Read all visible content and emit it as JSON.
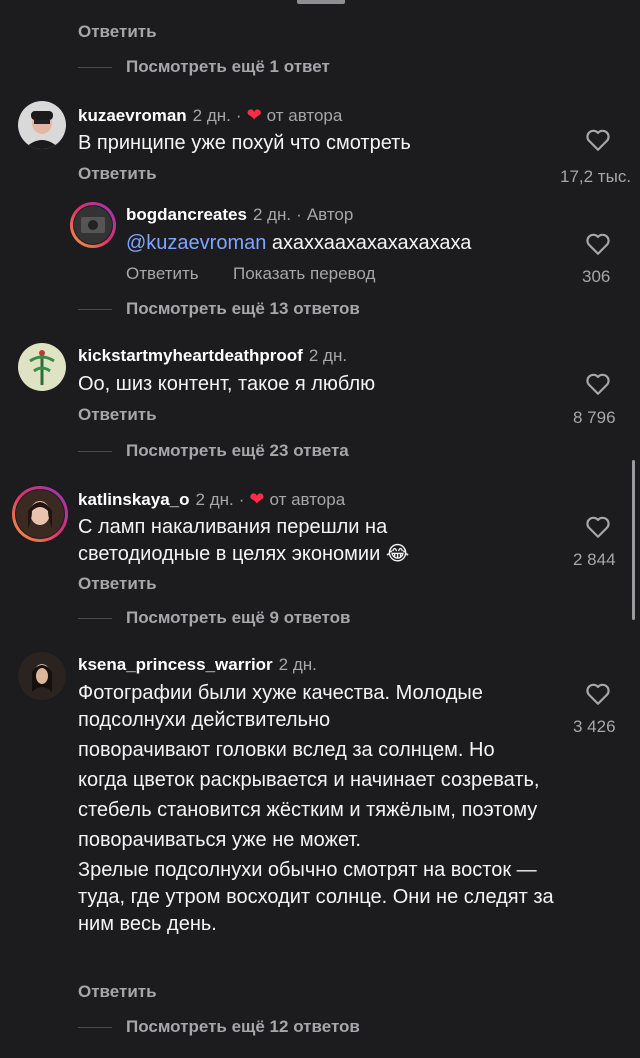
{
  "top": {
    "reply_label": "Ответить",
    "more_replies": "Посмотреть ещё 1 ответ"
  },
  "comments": [
    {
      "username": "kuzaevroman",
      "time": "2 дн.",
      "liked_by_author": "от автора",
      "text": "В принципе уже похуй что смотреть",
      "reply_label": "Ответить",
      "likes": "17,2 тыс.",
      "reply": {
        "username": "bogdancreates",
        "time": "2 дн.",
        "badge": "Автор",
        "mention": "@kuzaevroman",
        "text": " ахаххаахахахахахаха",
        "reply_label": "Ответить",
        "translate_label": "Показать перевод",
        "likes": "306"
      },
      "more_replies": "Посмотреть ещё 13 ответов"
    },
    {
      "username": "kickstartmyheartdeathproof",
      "time": "2 дн.",
      "text": "Оо, шиз контент, такое я люблю",
      "reply_label": "Ответить",
      "likes": "8 796",
      "more_replies": "Посмотреть ещё 23 ответа"
    },
    {
      "username": "katlinskaya_o",
      "time": "2 дн.",
      "liked_by_author": "от автора",
      "text_line1": "С ламп накаливания перешли на",
      "text_line2": "светодиодные  в целях экономии",
      "emoji": "😂",
      "reply_label": "Ответить",
      "likes": "2 844",
      "more_replies": "Посмотреть ещё 9 ответов"
    },
    {
      "username": "ksena_princess_warrior",
      "time": "2 дн.",
      "paragraphs": [
        "Фотографии были хуже качества. Молодые подсолнухи действительно",
        "поворачивают головки вслед за солнцем. Но",
        "когда цветок раскрывается и начинает созревать,",
        "стебель становится жёстким и тяжёлым, поэтому",
        "поворачиваться уже не может.",
        "Зрелые подсолнухи обычно смотрят на восток — туда, где утром восходит солнце. Они не следят за ним весь день."
      ],
      "reply_label": "Ответить",
      "likes": "3 426",
      "more_replies": "Посмотреть ещё 12 ответов"
    }
  ],
  "colors": {
    "background": "#1c1c1e",
    "heart": "#ff2d47",
    "mention": "#7da7ff",
    "muted": "#a6a6ab"
  }
}
